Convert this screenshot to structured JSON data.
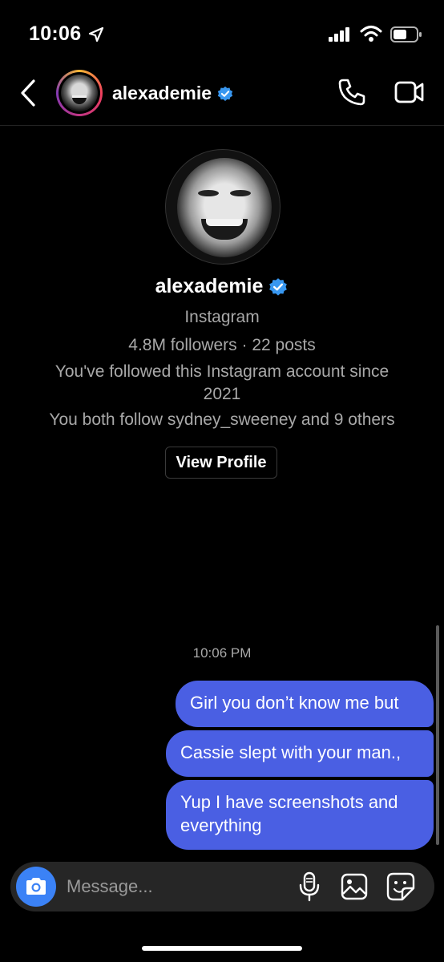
{
  "status_bar": {
    "time": "10:06",
    "icons": [
      "location-arrow-icon",
      "cellular-signal-icon",
      "wifi-icon",
      "battery-icon"
    ]
  },
  "header": {
    "username": "alexademie",
    "verified": true,
    "actions": [
      "phone-call-icon",
      "video-call-icon"
    ]
  },
  "profile": {
    "name": "alexademie",
    "platform": "Instagram",
    "stats": "4.8M followers · 22 posts",
    "follow_since_line1": "You've followed this Instagram account since",
    "follow_since_line2": "2021",
    "mutuals": "You both follow sydney_sweeney and 9 others",
    "view_profile_label": "View Profile"
  },
  "conversation": {
    "timestamp": "10:06 PM",
    "messages": [
      {
        "text": "Girl you don’t know me but",
        "from": "me"
      },
      {
        "text": "Cassie slept with your man.,",
        "from": "me"
      },
      {
        "text": "Yup I have screenshots and everything",
        "from": "me"
      }
    ]
  },
  "composer": {
    "placeholder": "Message...",
    "icons": [
      "camera-icon",
      "microphone-icon",
      "gallery-icon",
      "sticker-icon"
    ]
  },
  "colors": {
    "background": "#000000",
    "bubble": "#4a5fe3",
    "verified_badge": "#3897f0",
    "camera_button": "#3b82f6",
    "secondary_text": "#a8a8a8"
  }
}
